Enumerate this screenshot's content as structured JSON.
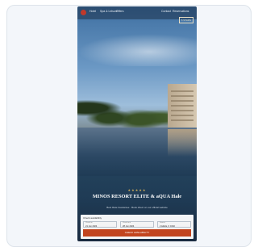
{
  "nav": {
    "links": [
      "Hotel",
      "Spa & Leisure",
      "Offers"
    ],
    "right": [
      "Contact",
      "Reservations"
    ],
    "badge": "5 STARS"
  },
  "hero": {
    "stars": "★★★★★",
    "title": "MINOS RESORT ELITE & aQUA Hale",
    "subtitle": "Best Rate Guarantee · Book direct on our official website"
  },
  "booking": {
    "heading": "Check availability",
    "fields": [
      {
        "label": "Check-in",
        "value": "21 Jun 2024"
      },
      {
        "label": "Check-out",
        "value": "28 Jun 2024"
      },
      {
        "label": "Guests",
        "value": "2 Adults, 0 Child"
      }
    ],
    "button": "CHECK AVAILABILITY"
  }
}
